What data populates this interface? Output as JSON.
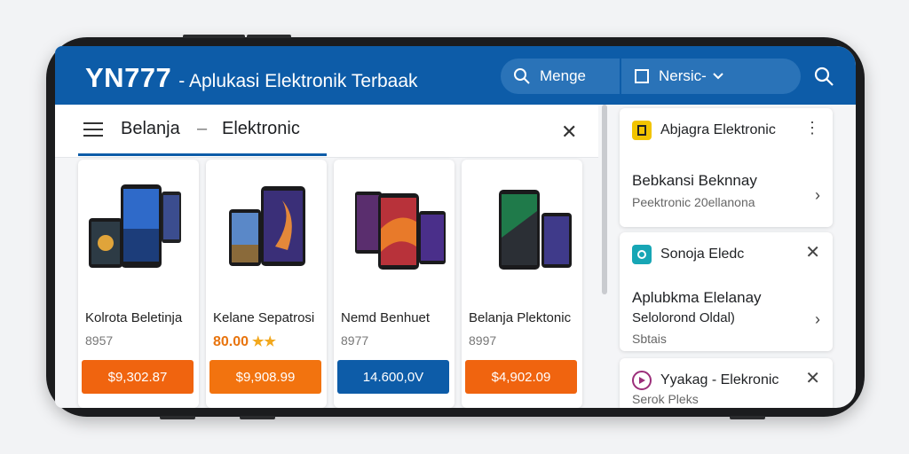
{
  "header": {
    "brand": "YN777",
    "subtitle": "- Aplukasi Elektronik Terbaak",
    "search_label": "Menge",
    "select_label": "Nersic-"
  },
  "tabs": {
    "tab1": "Belanja",
    "separator": "–",
    "tab2": "Elektronic"
  },
  "products": [
    {
      "name": "Kolrota Beletinja",
      "meta": "8957",
      "button": "$9,302.87",
      "button_color": "#f0640f"
    },
    {
      "name": "Kelane Sepatrosi",
      "meta": "80.00",
      "stars": "★★",
      "button": "$9,908.99",
      "button_color": "#f2730f"
    },
    {
      "name": "Nemd Benhuet",
      "meta": "8977",
      "button": "14.600,0V",
      "button_color": "#0d5ca8"
    },
    {
      "name": "Belanja Plektonic",
      "meta": "8997",
      "button": "$4,902.09",
      "button_color": "#f0640f"
    }
  ],
  "side": {
    "card1": {
      "title": "Abjagra Elektronic",
      "icon_color": "#f2c400",
      "line1": "Bebkansi Beknnay",
      "line2": "Peektronic 20ellanona"
    },
    "card2": {
      "title": "Sonoja Eledc",
      "icon_color": "#17a6b5",
      "line1": "Aplubkma Elelanay",
      "line1b": "Selolorond Oldal)",
      "line2": "Sbtais"
    },
    "card3": {
      "title": "Yyakag - Elekronic",
      "icon_color": "#9b2e7a",
      "line2": "Serok Pleks"
    }
  }
}
